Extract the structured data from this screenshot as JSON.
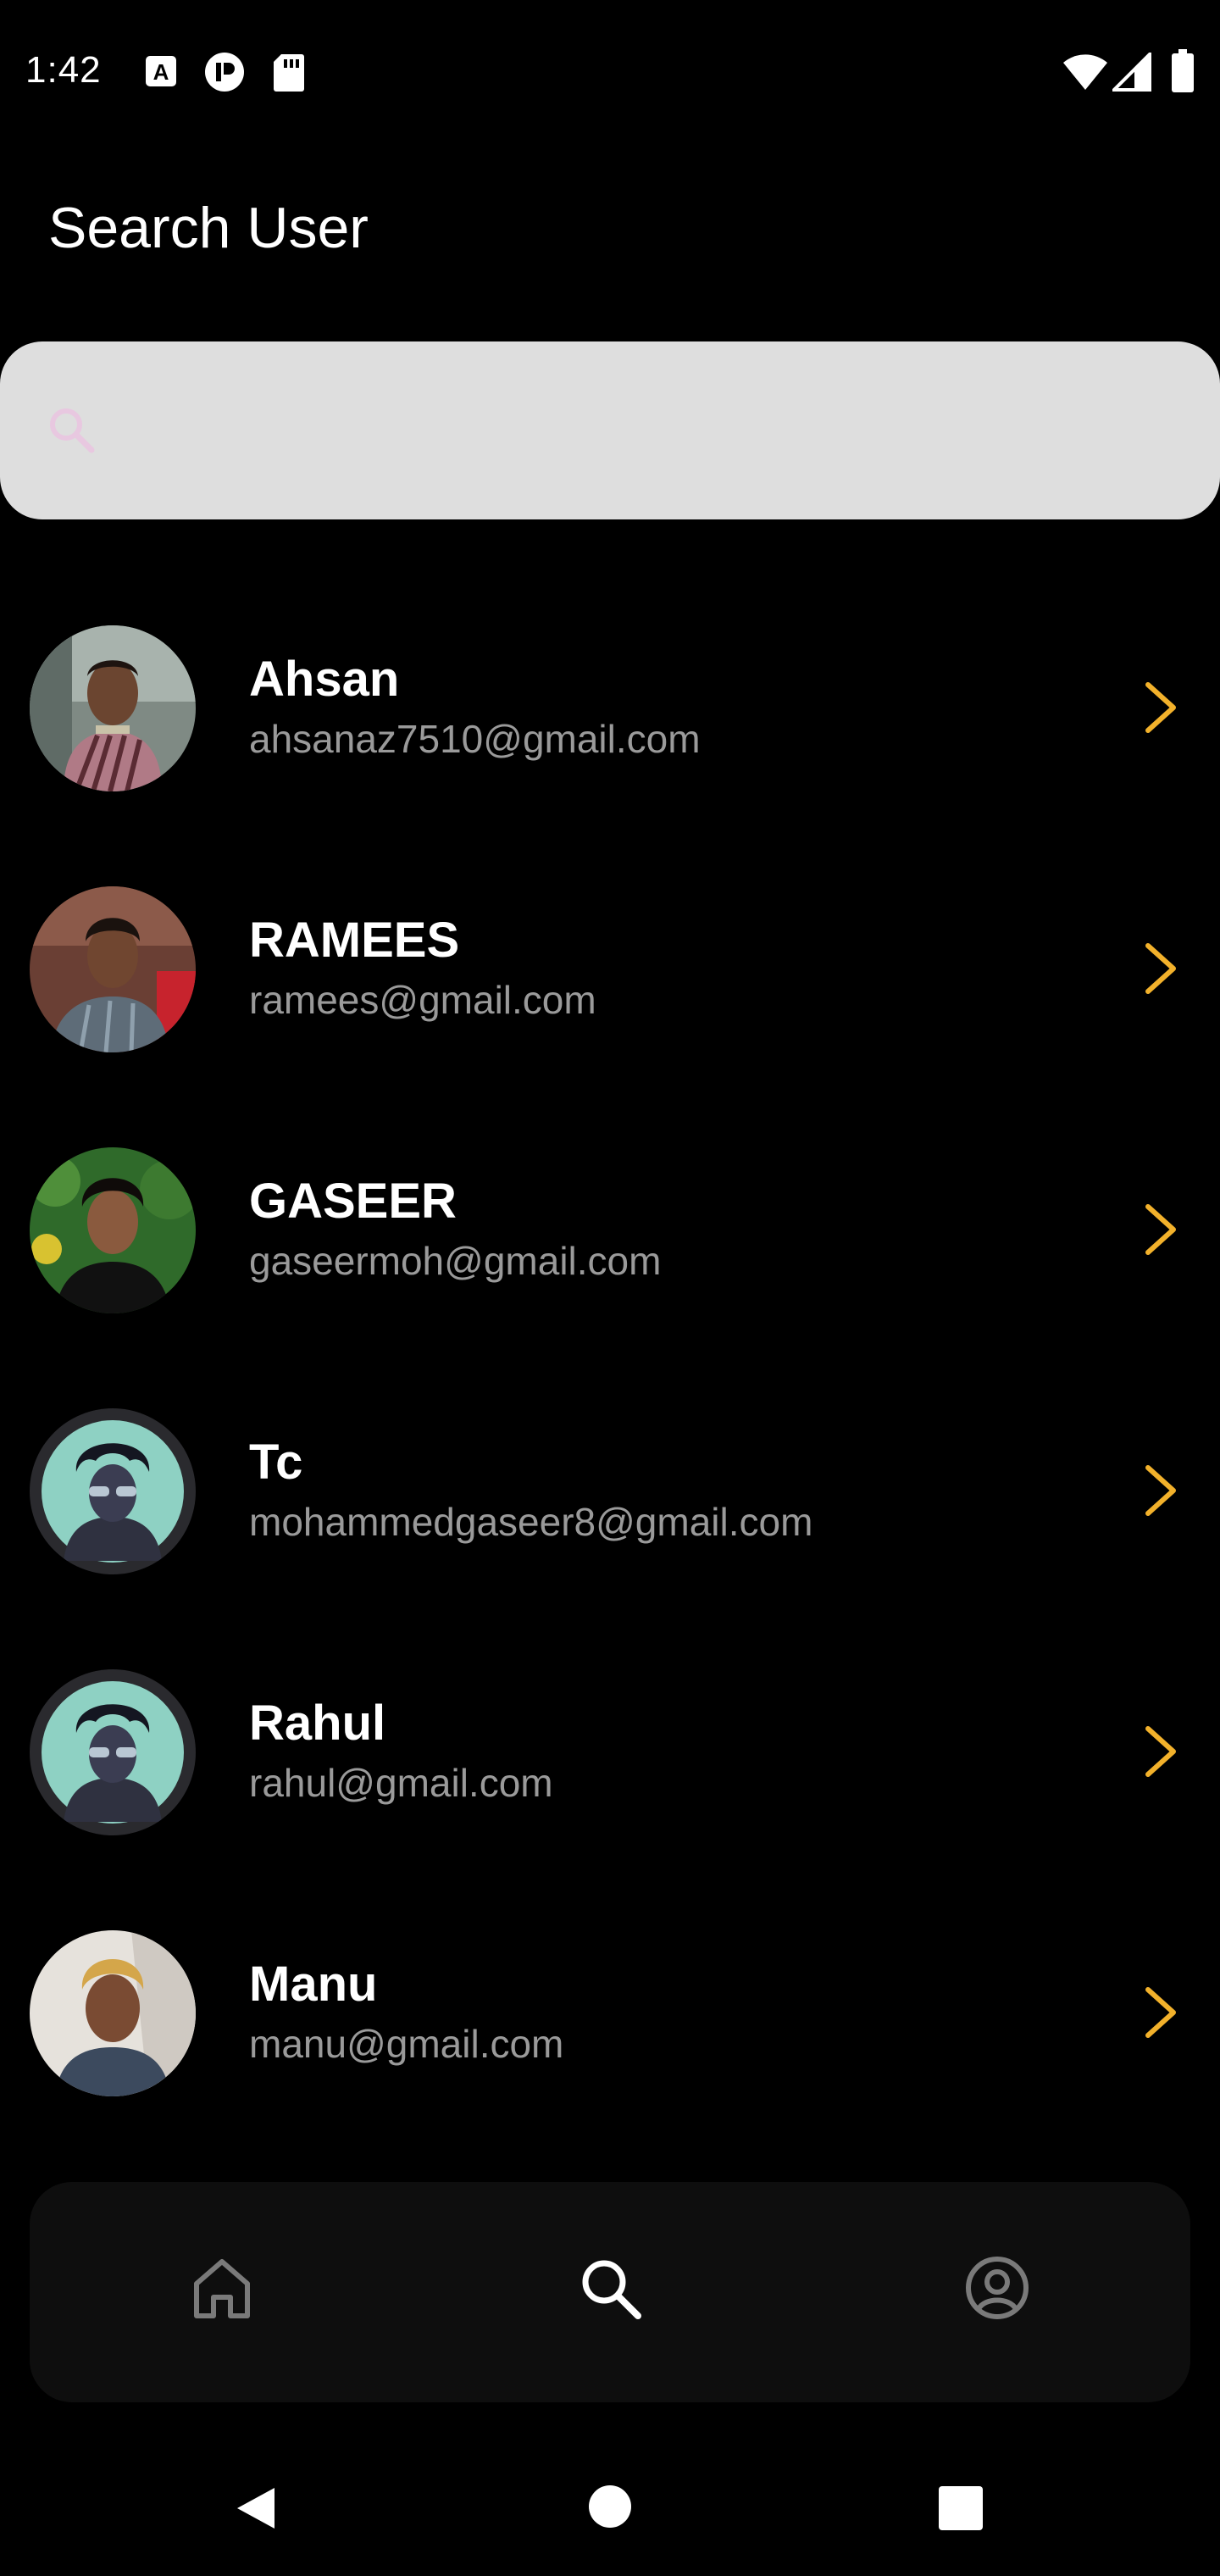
{
  "status_bar": {
    "time": "1:42"
  },
  "header": {
    "title": "Search User"
  },
  "search": {
    "placeholder": "",
    "value": ""
  },
  "users": [
    {
      "name": "Ahsan",
      "email": "ahsanaz7510@gmail.com"
    },
    {
      "name": "RAMEES",
      "email": "ramees@gmail.com"
    },
    {
      "name": "GASEER",
      "email": "gaseermoh@gmail.com"
    },
    {
      "name": "Tc",
      "email": "mohammedgaseer8@gmail.com"
    },
    {
      "name": "Rahul",
      "email": "rahul@gmail.com"
    },
    {
      "name": "Manu",
      "email": "manu@gmail.com"
    }
  ],
  "colors": {
    "background": "#000000",
    "accent_chevron": "#f2b12b",
    "search_bg": "#dedede",
    "search_icon": "#e8c8e0",
    "email_text": "#9a9a9a",
    "nav_bg": "#0e0e0e"
  },
  "icons": {
    "status": [
      "a-notification-icon",
      "app-notification-icon",
      "sd-card-icon",
      "wifi-icon",
      "signal-icon",
      "battery-icon"
    ],
    "nav": [
      "home-icon",
      "search-icon",
      "profile-icon"
    ],
    "system": [
      "back-icon",
      "home-circle-icon",
      "recents-icon"
    ]
  },
  "bottom_nav": {
    "active": "search"
  }
}
